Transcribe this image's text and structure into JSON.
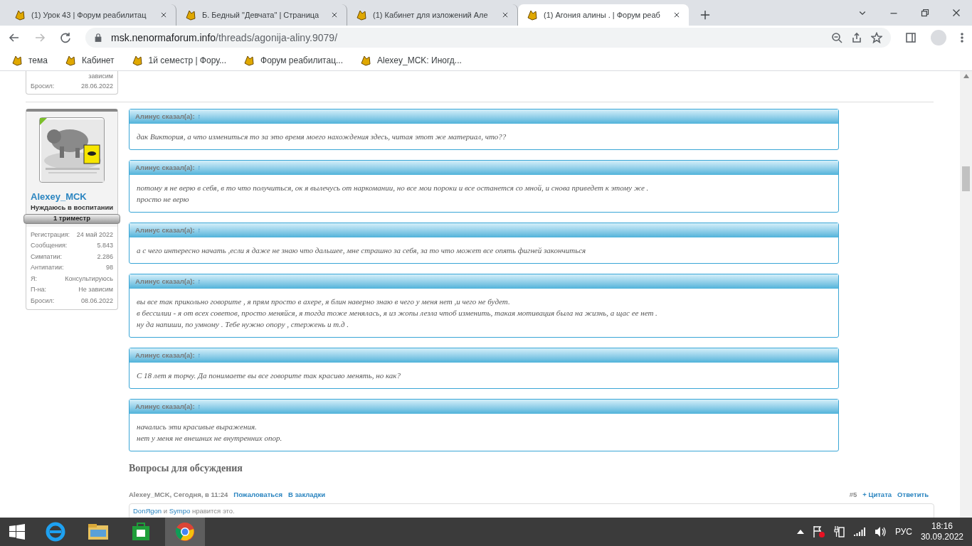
{
  "browser": {
    "tabs": [
      {
        "title": "(1) Урок 43 | Форум реабилитац",
        "selected": false
      },
      {
        "title": "Б. Бедный \"Девчата\" | Страница",
        "selected": false
      },
      {
        "title": "(1) Кабинет для изложений Але",
        "selected": false
      },
      {
        "title": "(1) Агония алины . | Форум реаб",
        "selected": true
      }
    ],
    "address": {
      "host": "msk.nenormaforum.info",
      "path": "/threads/agonija-aliny.9079/"
    },
    "bookmarks": [
      "тема",
      "Кабинет",
      "1й семестр | Фору...",
      "Форум реабилитац...",
      "Alexey_MCK: Иногд..."
    ]
  },
  "prev_card": {
    "rows": [
      {
        "label": "",
        "value": "зависим"
      },
      {
        "label": "Бросил:",
        "value": "28.06.2022"
      }
    ]
  },
  "author": {
    "name": "Alexey_MCK",
    "title": "Нуждаюсь в воспитании",
    "rank": "1 триместр",
    "online": true,
    "stats": [
      {
        "label": "Регистрация:",
        "value": "24 май 2022"
      },
      {
        "label": "Сообщения:",
        "value": "5.843"
      },
      {
        "label": "Симпатии:",
        "value": "2.286"
      },
      {
        "label": "Антипатии:",
        "value": "98"
      },
      {
        "label": "Я:",
        "value": "Консультируюсь"
      },
      {
        "label": "П-на:",
        "value": "Не зависим"
      },
      {
        "label": "Бросил:",
        "value": "08.06.2022"
      }
    ]
  },
  "quotes": [
    {
      "attribution": "Алинус сказал(а):",
      "arrow": "↑",
      "lines": [
        "дак Виктория, а что измениться то за это время моего нахождения здесь, читая этот же материал, что??"
      ]
    },
    {
      "attribution": "Алинус сказал(а):",
      "arrow": "↑",
      "lines": [
        "потому я не верю в себя, в то что получиться, ок я вылечусь от наркомании, но все мои пороки и все останется со мной, и снова приведет к этому же .",
        "просто не верю"
      ]
    },
    {
      "attribution": "Алинус сказал(а):",
      "arrow": "↑",
      "lines": [
        "а с чего интересно начать ,если я даже не знаю что дальшее, мне страшно за себя, за то что может все опять фигней закончиться"
      ]
    },
    {
      "attribution": "Алинус сказал(а):",
      "arrow": "↑",
      "lines": [
        "вы все так прикольно говорите , я прям просто в ахере, я блин наверно знаю в чего у меня нет ,и чего не будет.",
        "в бессилии - я от всех советов, просто меняйся, я тогда тоже менялась, я из жопы лезла чтоб изменить, такая мотивация была на жизнь, а щас ее нет .",
        "ну да напиши, по умному . Тебе нужно опору , стержень и т.д ."
      ]
    },
    {
      "attribution": "Алинус сказал(а):",
      "arrow": "↑",
      "lines": [
        "С 18 лет я торчу. Да понимаете вы все говорите так красиво менять, но как?"
      ]
    },
    {
      "attribution": "Алинус сказал(а):",
      "arrow": "↑",
      "lines": [
        "начались эти красивые выражения.",
        "нет у меня не внешних не внутренних опор."
      ]
    }
  ],
  "heading": "Вопросы для обсуждения",
  "footer": {
    "meta": "Alexey_MCK, Сегодня, в 11:24",
    "links": [
      "Пожаловаться",
      "В закладки"
    ],
    "number": "#5",
    "actions": [
      "+ Цитата",
      "Ответить"
    ]
  },
  "likes": {
    "users": [
      "DonЯgon",
      "Sympo"
    ],
    "joiner": "и",
    "suffix": "нравится это."
  },
  "taskbar": {
    "language": "РУС",
    "time": "18:16",
    "date": "30.09.2022"
  }
}
